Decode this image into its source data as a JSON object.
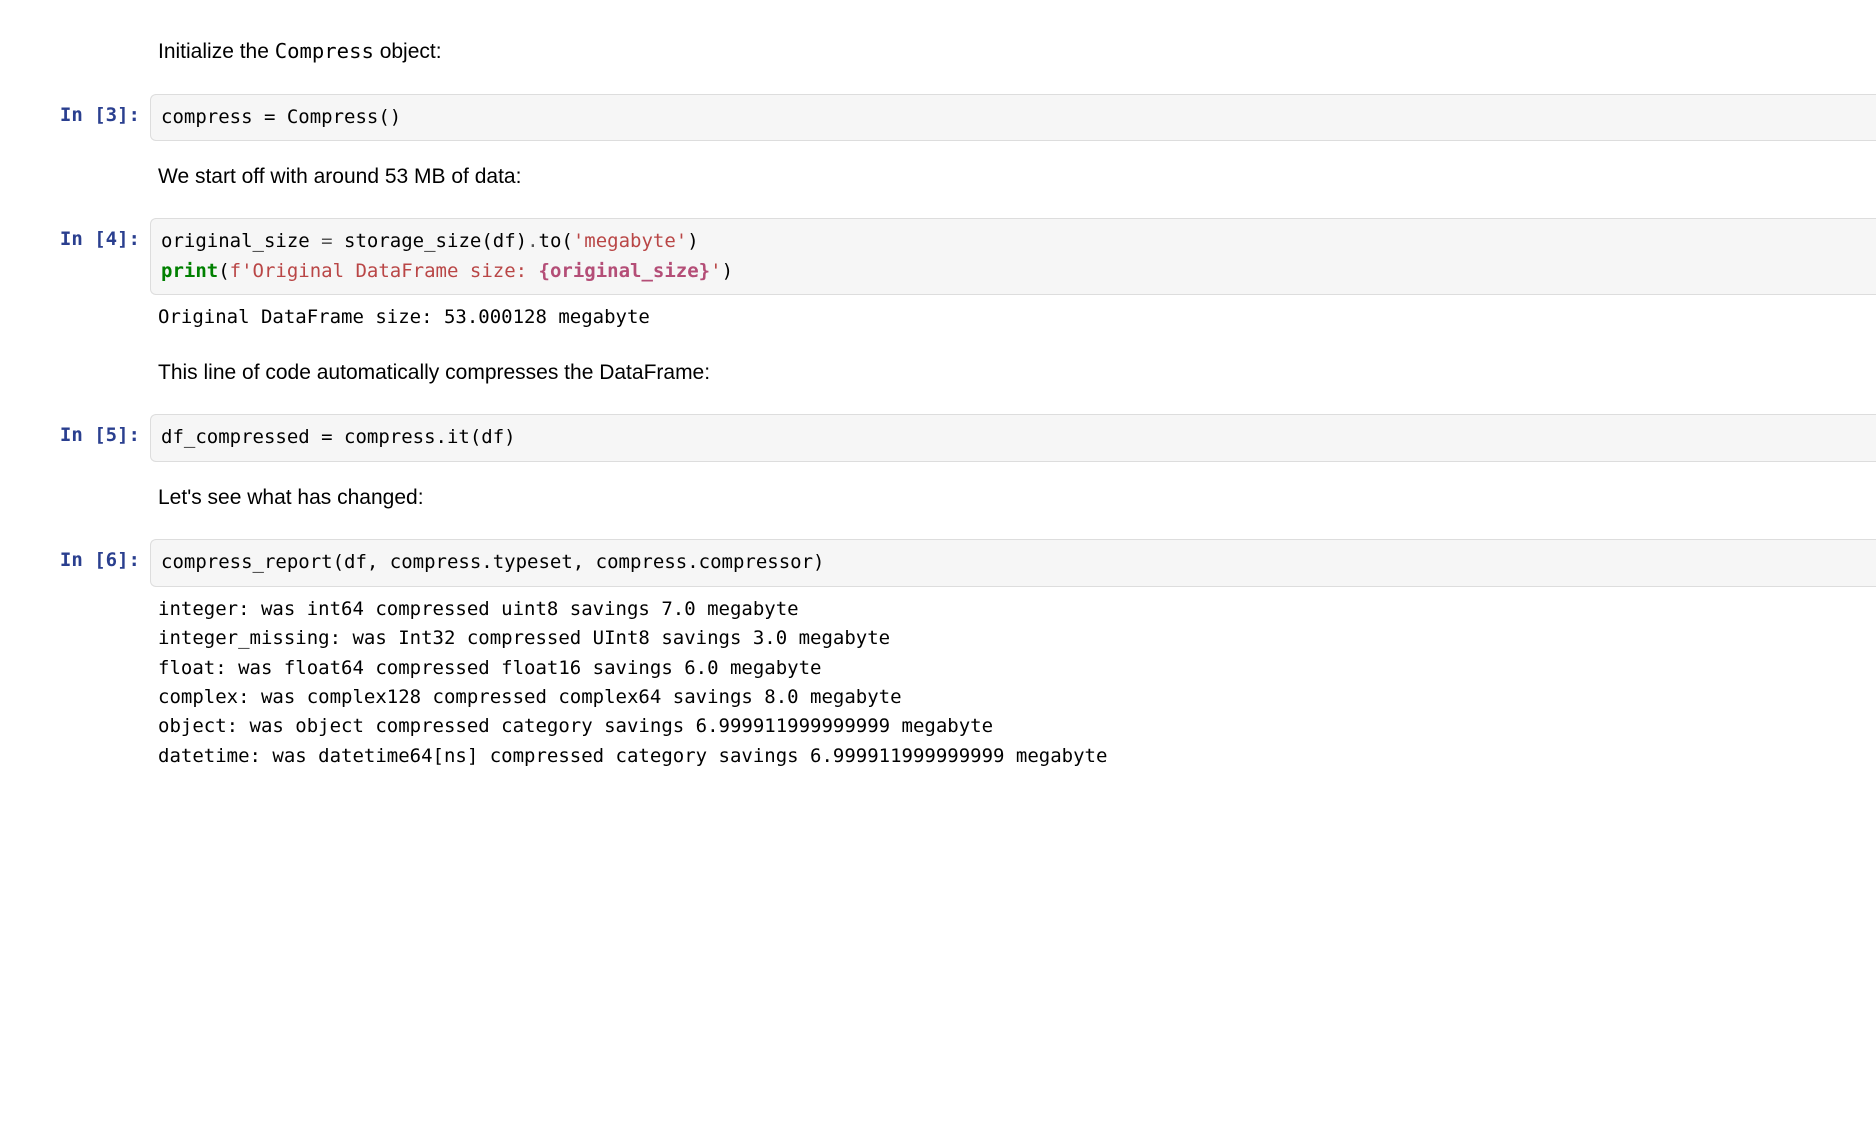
{
  "cells": [
    {
      "kind": "md",
      "prompt": "",
      "pre_text": "Initialize the ",
      "code_inline": "Compress",
      "post_text": " object:"
    },
    {
      "kind": "code",
      "prompt": "In [3]:",
      "code_plain": "compress = Compress()"
    },
    {
      "kind": "md",
      "prompt": "",
      "pre_text": "We start off with around 53 MB of data:",
      "code_inline": "",
      "post_text": ""
    },
    {
      "kind": "code",
      "prompt": "In [4]:",
      "code_plain": "original_size = storage_size(df).to('megabyte')\nprint(f'Original DataFrame size: {original_size}')",
      "line1_parts": {
        "a": "original_size ",
        "op": "=",
        "b": " storage_size(df)",
        "dot": ".",
        "c": "to(",
        "str": "'megabyte'",
        "d": ")"
      },
      "line2_parts": {
        "print": "print",
        "open": "(",
        "fpre": "f'Original DataFrame size: ",
        "interp": "{original_size}",
        "fpost": "'",
        "close": ")"
      },
      "output": "Original DataFrame size: 53.000128 megabyte"
    },
    {
      "kind": "md",
      "prompt": "",
      "pre_text": "This line of code automatically compresses the DataFrame:",
      "code_inline": "",
      "post_text": ""
    },
    {
      "kind": "code",
      "prompt": "In [5]:",
      "code_plain": "df_compressed = compress.it(df)"
    },
    {
      "kind": "md",
      "prompt": "",
      "pre_text": "Let's see what has changed:",
      "code_inline": "",
      "post_text": ""
    },
    {
      "kind": "code",
      "prompt": "In [6]:",
      "code_plain": "compress_report(df, compress.typeset, compress.compressor)",
      "output": "integer: was int64 compressed uint8 savings 7.0 megabyte\ninteger_missing: was Int32 compressed UInt8 savings 3.0 megabyte\nfloat: was float64 compressed float16 savings 6.0 megabyte\ncomplex: was complex128 compressed complex64 savings 8.0 megabyte\nobject: was object compressed category savings 6.999911999999999 megabyte\ndatetime: was datetime64[ns] compressed category savings 6.999911999999999 megabyte"
    }
  ]
}
